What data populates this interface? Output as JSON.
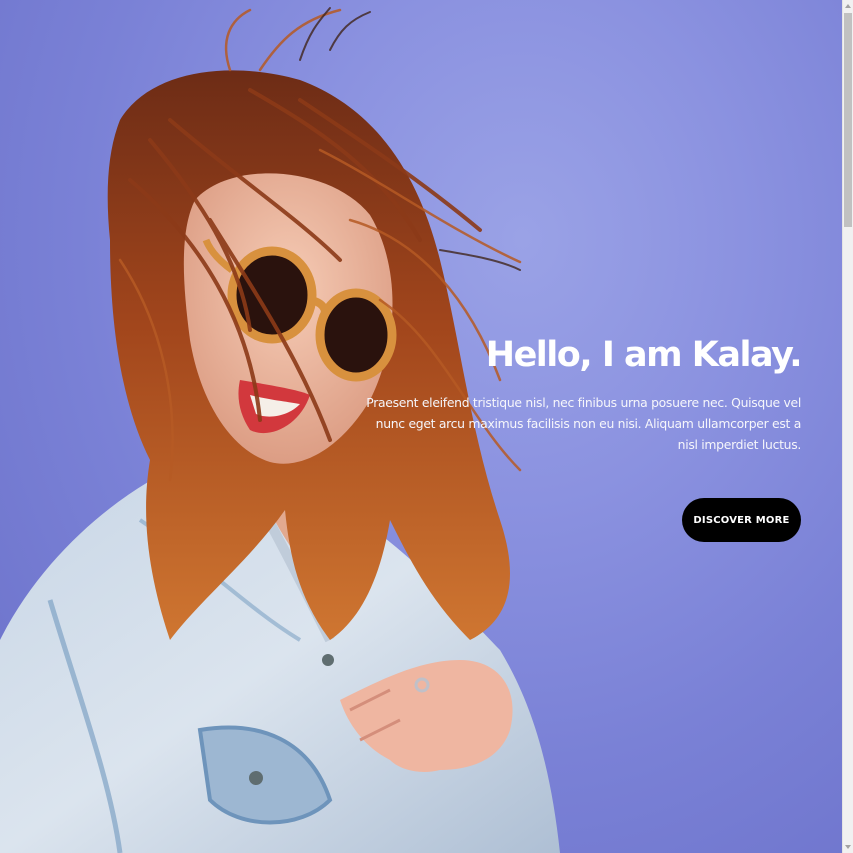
{
  "hero": {
    "title": "Hello, I am Kalay.",
    "description": "Praesent eleifend tristique nisl, nec finibus urna posuere nec. Quisque vel nunc eget arcu maximus facilisis non eu nisi. Aliquam ullamcorper est a nisl imperdiet luctus.",
    "button_label": "DISCOVER MORE",
    "background_color": "#8b92e0",
    "button_color": "#000000",
    "text_color": "#ffffff"
  },
  "photo": {
    "subject": "woman-with-sunglasses-and-windblown-hair"
  },
  "scrollbar": {
    "up_icon": "scroll-up-arrow-icon",
    "down_icon": "scroll-down-arrow-icon"
  }
}
